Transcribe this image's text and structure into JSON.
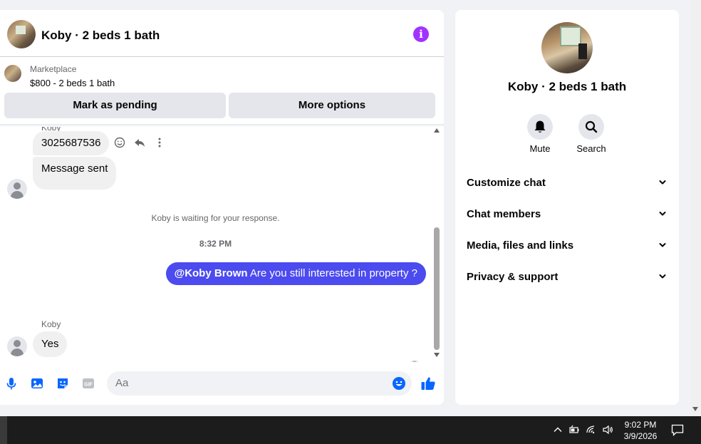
{
  "header": {
    "title": "Koby · 2 beds 1 bath",
    "info_icon": "info-icon"
  },
  "listing": {
    "label": "Marketplace",
    "price": "$800 - 2 beds 1 bath"
  },
  "actions": {
    "pending": "Mark as pending",
    "more": "More options"
  },
  "messages": {
    "cut_sender": "Koby",
    "first": "3025687536",
    "second": "Message sent",
    "status": "Koby is waiting for your response.",
    "time": "8:32 PM",
    "outgoing_mention": "@Koby Brown",
    "outgoing_text": " Are you still interested in property ?",
    "sender": "Koby",
    "reply": "Yes"
  },
  "composer": {
    "placeholder": "Aa"
  },
  "info_panel": {
    "title": "Koby · 2 beds 1 bath",
    "mute": "Mute",
    "search": "Search",
    "sections": [
      "Customize chat",
      "Chat members",
      "Media, files and links",
      "Privacy & support"
    ]
  },
  "taskbar": {
    "time": "9:02 PM",
    "date": "3/9/2026"
  },
  "colors": {
    "accent": "#4b4bf0",
    "messenger_blue": "#0866ff",
    "info_purple": "#a033ff"
  }
}
